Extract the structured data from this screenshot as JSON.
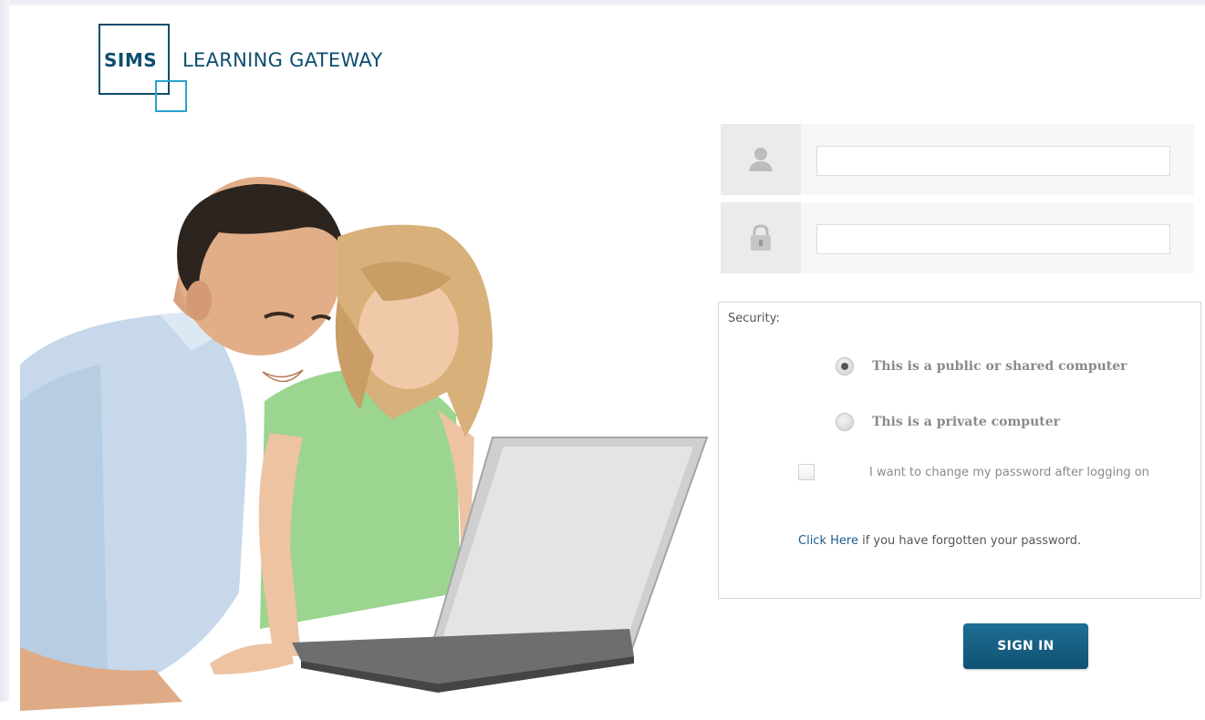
{
  "logo": {
    "brand": "SIMS",
    "product": "LEARNING GATEWAY"
  },
  "hero": {
    "icon": "family-laptop-photo"
  },
  "login": {
    "username": {
      "icon": "user-icon",
      "value": "",
      "placeholder": ""
    },
    "password": {
      "icon": "lock-icon",
      "value": "",
      "placeholder": ""
    }
  },
  "security": {
    "label": "Security:",
    "options": [
      {
        "label": "This is a public or shared computer",
        "selected": true
      },
      {
        "label": "This is a private computer",
        "selected": false
      }
    ],
    "change_password_label": "I want to change my password after logging on",
    "change_password_checked": false,
    "forgot_link": "Click Here",
    "forgot_text": "if you have forgotten your password."
  },
  "signin_button": "SIGN IN",
  "colors": {
    "brand_dark": "#0d4d6e",
    "brand_light": "#27a4cc",
    "button": "#1a6489",
    "link": "#1e5b8a"
  }
}
